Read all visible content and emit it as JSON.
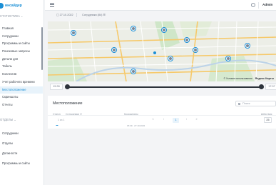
{
  "sidebar": {
    "logo_text": "инсайдер",
    "section1_title": "СТАТИСТИКА",
    "section1_items": [
      {
        "label": "Главная"
      },
      {
        "label": "Сотрудники"
      },
      {
        "label": "Программы и сайты"
      },
      {
        "label": "Поисковые запросы"
      },
      {
        "label": "Детали дня"
      },
      {
        "label": "Табель"
      },
      {
        "label": "Коллектив"
      },
      {
        "label": "Учет рабочего времени"
      },
      {
        "label": "Местоположение"
      },
      {
        "label": "Скриншоты"
      },
      {
        "label": "Отчеты"
      }
    ],
    "active_item": "Местоположение",
    "section2_title": "ОТДЕЛЫ",
    "section2_items": [
      {
        "label": "Сотрудники"
      },
      {
        "label": "Отделы"
      },
      {
        "label": "Должности"
      },
      {
        "label": "Программы и сайты"
      }
    ]
  },
  "topbar": {
    "user_name": "Admin"
  },
  "filters": {
    "date": "27.10.2022",
    "employees": "Сотрудники (84)"
  },
  "map": {
    "attribution": "© Условия использования",
    "brand": "Яндекс Карты"
  },
  "timeline": {
    "start_time": "15:39",
    "end_time": "17:07"
  },
  "location": {
    "title": "Местоположение",
    "search_placeholder": "Поиск",
    "columns": {
      "status": "Статус",
      "employee": "Сотрудники ▼",
      "coordinates": "Координаты",
      "actions": "Действия"
    },
    "rows": [
      {
        "name": "Петрова Александра",
        "coordinates": "Анапский пр-т",
        "time": "15:39 · 27.10.2022"
      }
    ]
  },
  "pagination": {
    "total": "1 из 1",
    "first": "«",
    "prev": "‹",
    "page": "1",
    "next": "›",
    "last": "»",
    "per_page": "25"
  },
  "colors": {
    "accent": "#1a8fd6",
    "text": "#2d333b"
  }
}
